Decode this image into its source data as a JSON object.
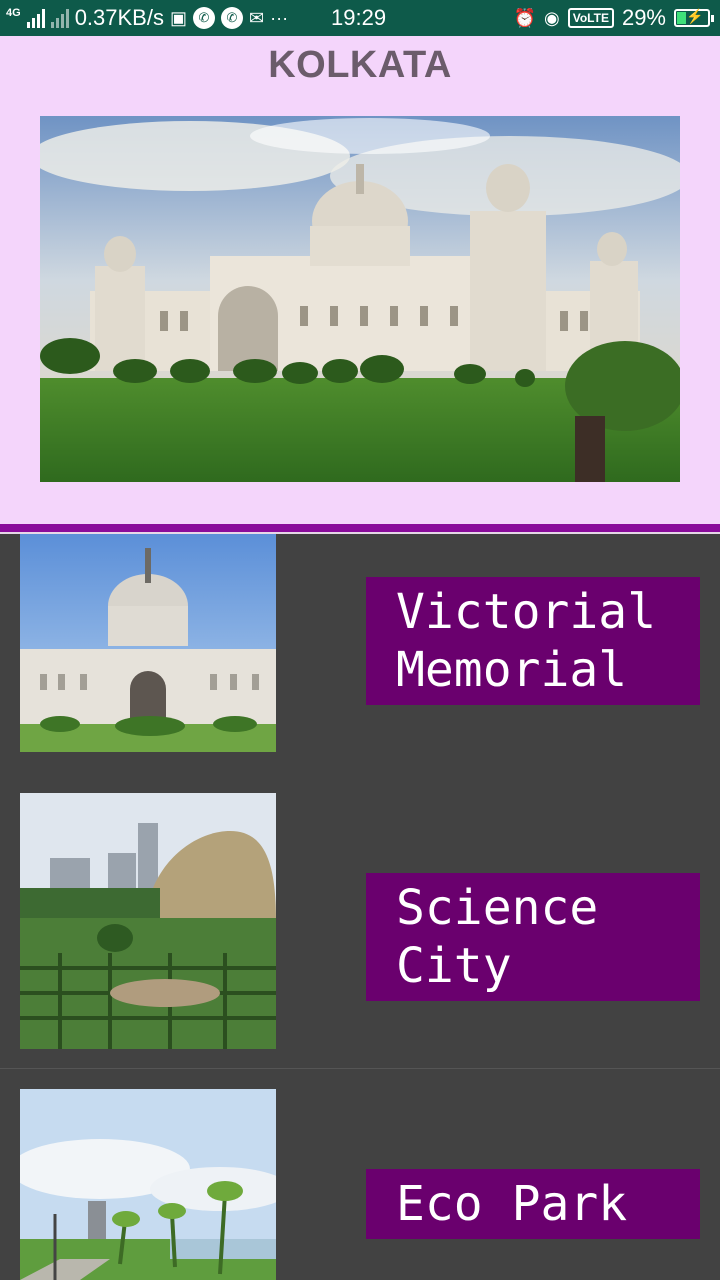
{
  "status_bar": {
    "network_type": "4G",
    "data_speed": "0.37KB/s",
    "time": "19:29",
    "volte": "VoLTE",
    "battery": "29%",
    "icons": [
      "signal-icon",
      "calendar-icon",
      "whatsapp-icon",
      "whatsapp-icon",
      "mail-icon",
      "more-icon",
      "alarm-icon",
      "eye-icon",
      "battery-charging-icon"
    ]
  },
  "header": {
    "title": "KOLKATA",
    "hero_image": "victoria-memorial-photo"
  },
  "places": [
    {
      "label": "Victorial\nMemorial",
      "image": "victoria-memorial-thumbnail"
    },
    {
      "label": "Science\nCity",
      "image": "science-city-thumbnail"
    },
    {
      "label": "Eco Park",
      "image": "eco-park-thumbnail"
    }
  ],
  "colors": {
    "status_bar": "#0e5a4a",
    "header_bg": "#f4d5fb",
    "title_text": "#6b5c6b",
    "divider": "#8a0b9b",
    "list_bg": "#424242",
    "label_bg": "#6a006e",
    "label_text": "#ffffff"
  }
}
